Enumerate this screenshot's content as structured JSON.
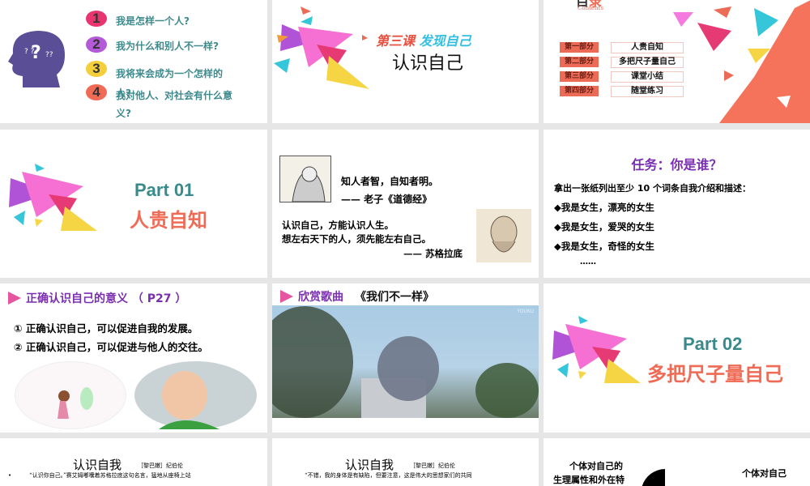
{
  "slides": {
    "s1": {
      "numbers": [
        "1",
        "2",
        "3",
        "4"
      ],
      "questions": [
        "我是怎样一个人?",
        "我为什么和别人不一样?",
        "我将来会成为一个怎样的人?",
        "我对他人、对社会有什么意义?"
      ],
      "colors": [
        "#e8356f",
        "#a957d4",
        "#f4cf3a",
        "#ef6b55"
      ]
    },
    "s2": {
      "lesson": "第三课",
      "subtitle": "发现自己",
      "title": "认识自己"
    },
    "s3": {
      "contents": "Contents",
      "tags": [
        "第一部分",
        "第二部分",
        "第三部分",
        "第四部分"
      ],
      "items": [
        "人贵自知",
        "多把尺子量自己",
        "课堂小结",
        "随堂练习"
      ]
    },
    "s4": {
      "part": "Part  01",
      "title": "人贵自知"
    },
    "s5": {
      "quote1": "知人者智，自知者明。",
      "source1": "—— 老子《道德经》",
      "quote2a": "认识自己，方能认识人生。",
      "quote2b": "想左右天下的人，须先能左右自己。",
      "source2": "—— 苏格拉底"
    },
    "s6": {
      "title": "任务：你是谁？",
      "intro": "拿出一张纸列出至少 10 个词条自我介绍和描述：",
      "bullets": [
        "◆我是女生，漂亮的女生",
        "◆我是女生，爱哭的女生",
        "◆我是女生，奇怪的女生"
      ],
      "ellipsis": "……"
    },
    "s7": {
      "title": "正确认识自己的意义 （ P27 ）",
      "points": [
        "① 正确认识自己，可以促进自我的发展。",
        "② 正确认识自己，可以促进与他人的交往。"
      ]
    },
    "s8": {
      "label": "欣赏歌曲",
      "song": "《我们不一样》",
      "watermark": "YOUKU"
    },
    "s9": {
      "part": "Part  02",
      "title": "多把尺子量自己"
    },
    "s10": {
      "title": "认识自我",
      "author": "［黎巴嫩］纪伯伦",
      "bullet": "•",
      "text": "“认识你自己。”赛艾姆嘟囔着苏格拉底这句名言，猛地从座椅上站"
    },
    "s11": {
      "title": "认识自我",
      "author": "［黎巴嫩］纪伯伦",
      "text": "“不错，我的身体是有缺陷，但要注意，这是伟大的思想家们的共同"
    },
    "s12": {
      "left1": "个体对自己的",
      "left2": "生理属性和外在特",
      "right1": "个体对自己"
    }
  },
  "colors": {
    "teal": "#3a8a8c",
    "coral": "#ef6b55",
    "purple": "#7a2fb0"
  }
}
